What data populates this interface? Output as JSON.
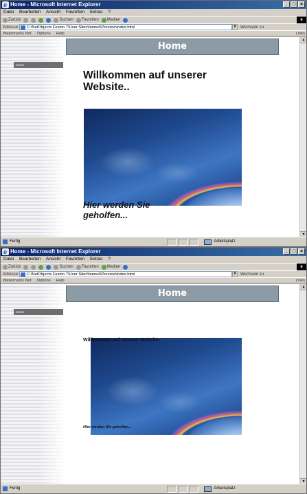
{
  "windows": [
    {
      "title": "Home - Microsoft Internet Explorer",
      "menu": [
        "Datei",
        "Bearbeiten",
        "Ansicht",
        "Favoriten",
        "Extras",
        "?"
      ],
      "toolbar": {
        "back": "Zurück",
        "search": "Suchen",
        "favorites": "Favoriten",
        "media": "Medien"
      },
      "address": {
        "label": "Adresse",
        "url": "C:\\NetObjects Fusion 7\\User Sites\\fanneil\\Preview\\index.html",
        "go": "Wechseln zu"
      },
      "links_bar": {
        "watermark": "Watermarks Not",
        "options": "Options",
        "help": "Help",
        "links": "Links"
      },
      "page": {
        "banner": "Home",
        "nav_button": "Home",
        "headline": "Willkommen auf unserer Website..",
        "tagline": "Hier werden Sie geholfen..."
      },
      "status": {
        "text": "Fertig",
        "zone": "Arbeitsplatz"
      }
    },
    {
      "title": "Home - Microsoft Internet Explorer",
      "menu": [
        "Datei",
        "Bearbeiten",
        "Ansicht",
        "Favoriten",
        "Extras",
        "?"
      ],
      "toolbar": {
        "back": "Zurück",
        "search": "Suchen",
        "favorites": "Favoriten",
        "media": "Medien"
      },
      "address": {
        "label": "Adresse",
        "url": "C:\\NetObjects Fusion 7\\User Sites\\fanneil\\Preview\\index.html",
        "go": "Wechseln zu"
      },
      "links_bar": {
        "watermark": "Watermarks Not",
        "options": "Options",
        "help": "Help",
        "links": "Links"
      },
      "page": {
        "banner": "Home",
        "nav_button": "Home",
        "headline": "Willkommen auf unserer Website.",
        "tagline": "Hier werden Sie geholfen..."
      },
      "status": {
        "text": "Fertig",
        "zone": "Arbeitsplatz"
      }
    }
  ],
  "colors": {
    "titlebar": "#0a246a",
    "banner": "#8d9ba6",
    "nav_button": "#6e6e6e"
  }
}
